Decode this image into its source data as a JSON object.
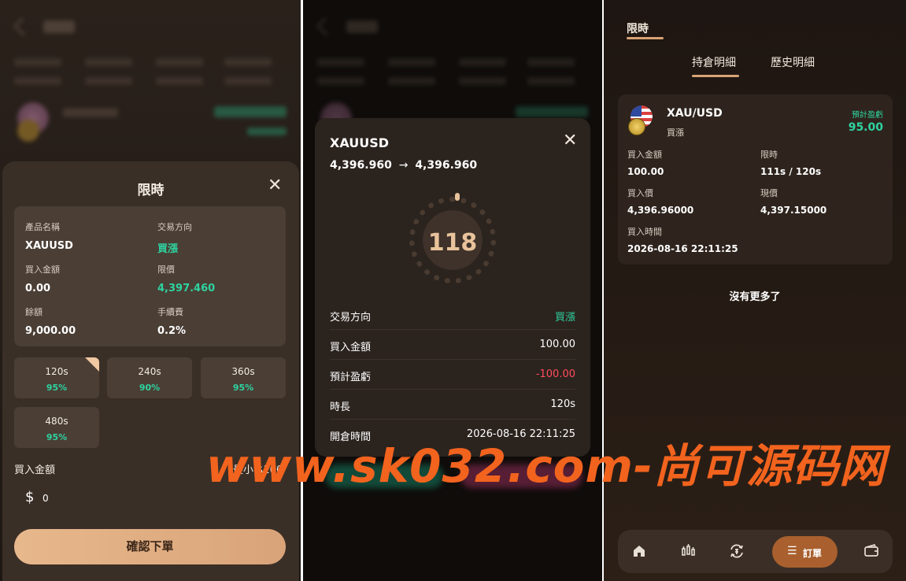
{
  "panel1": {
    "sheet_title": "限時",
    "close_icon": "close-icon",
    "info": {
      "product_label": "產品名稱",
      "product_value": "XAUUSD",
      "direction_label": "交易方向",
      "direction_value": "買漲",
      "amount_label": "買入金額",
      "amount_value": "0.00",
      "limit_label": "限價",
      "limit_value": "4,397.460",
      "balance_label": "餘額",
      "balance_value": "9,000.00",
      "fee_label": "手續費",
      "fee_value": "0.2%"
    },
    "durations": [
      {
        "time": "120s",
        "rate": "95%",
        "selected": true
      },
      {
        "time": "240s",
        "rate": "90%",
        "selected": false
      },
      {
        "time": "360s",
        "rate": "95%",
        "selected": false
      },
      {
        "time": "480s",
        "rate": "95%",
        "selected": false
      }
    ],
    "amount_input_label": "買入金額",
    "amount_min": "最小 $100",
    "currency_symbol": "$",
    "amount_input_value": "0",
    "confirm_label": "確認下單",
    "accent_color": "#e7b88c",
    "up_color": "#2ed3a0"
  },
  "panel2": {
    "title": "XAUUSD",
    "price_from": "4,396.960",
    "arrow": "→",
    "price_to": "4,396.960",
    "countdown": "118",
    "rows": [
      {
        "key": "交易方向",
        "value": "買漲",
        "tone": "green"
      },
      {
        "key": "買入金額",
        "value": "100.00",
        "tone": ""
      },
      {
        "key": "預計盈虧",
        "value": "-100.00",
        "tone": "red"
      },
      {
        "key": "時長",
        "value": "120s",
        "tone": ""
      },
      {
        "key": "開倉時間",
        "value": "2026-08-16 22:11:25",
        "tone": ""
      }
    ]
  },
  "panel3": {
    "tab": "限時",
    "sub_tabs": [
      "持倉明細",
      "歷史明細"
    ],
    "card": {
      "symbol": "XAU/USD",
      "direction": "買漲",
      "pl_label": "預計盈虧",
      "pl_value": "95.00",
      "amount_label": "買入金額",
      "amount_value": "100.00",
      "limit_label": "限時",
      "limit_value": "111s / 120s",
      "buy_price_label": "買入價",
      "buy_price_value": "4,396.96000",
      "cur_price_label": "現價",
      "cur_price_value": "4,397.15000",
      "buy_time_label": "買入時間",
      "buy_time_value": "2026-08-16 22:11:25"
    },
    "no_more": "沒有更多了",
    "nav": {
      "items": [
        "home-icon",
        "market-icon",
        "exchange-icon",
        "wallet-icon"
      ],
      "active_label": "訂單",
      "active_icon": "list-icon"
    }
  },
  "watermark": "www.sk032.com-尚可源码网"
}
